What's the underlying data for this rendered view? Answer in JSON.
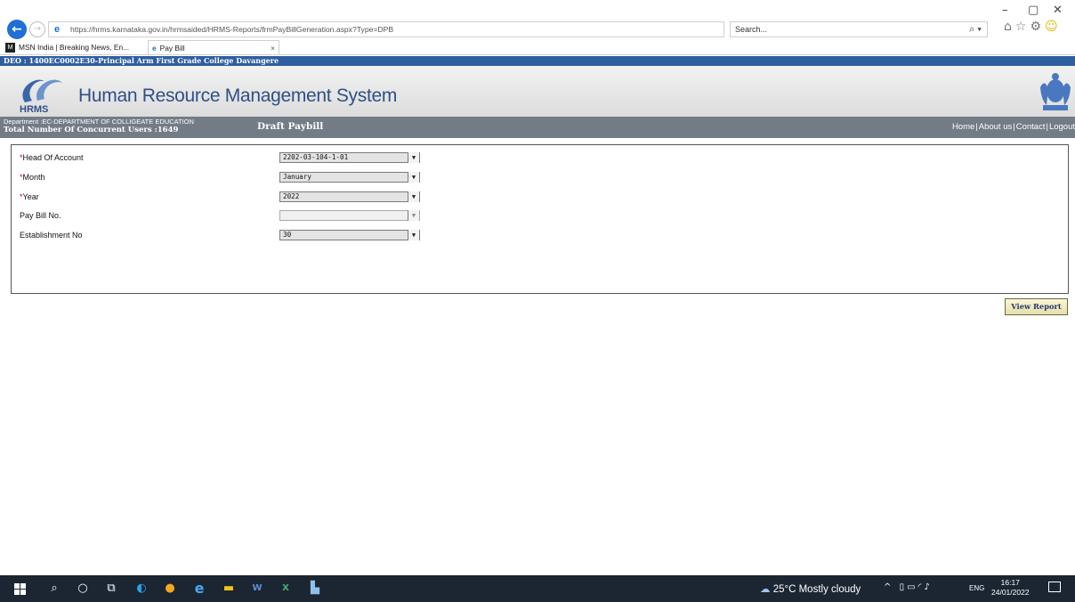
{
  "browser": {
    "url": "https://hrms.karnataka.gov.in/hrmsaided/HRMS-Reports/frmPayBillGeneration.aspx?Type=DPB",
    "search_placeholder": "Search...",
    "tabs": [
      {
        "label": "MSN India | Breaking News, En..."
      },
      {
        "label": "Pay Bill"
      }
    ]
  },
  "page": {
    "deo_text": "DEO : 1400EC0002E30-Principal Arm First Grade College Davangere",
    "system_title": "Human Resource Management System",
    "logo_text": "HRMS",
    "department": "Department :EC-DEPARTMENT OF COLLIGEATE EDUCATION",
    "concurrent_users": "Total Number Of Concurrent Users :1649",
    "heading": "Draft Paybill",
    "links": [
      "Home",
      "About us",
      "Contact",
      "Logout"
    ]
  },
  "form": {
    "fields": [
      {
        "label": "Head Of Account",
        "required": "*",
        "value": "2202-03-104-1-01"
      },
      {
        "label": "Month",
        "required": "*",
        "value": "January"
      },
      {
        "label": "Year",
        "required": "*",
        "value": "2022"
      },
      {
        "label": "Pay Bill No.",
        "required": "",
        "value": ""
      },
      {
        "label": "Establishment No",
        "required": "",
        "value": "30"
      }
    ],
    "submit_label": "View Report"
  },
  "taskbar": {
    "weather": "25°C Mostly cloudy",
    "language": "ENG",
    "time": "16:17",
    "date": "24/01/2022"
  }
}
